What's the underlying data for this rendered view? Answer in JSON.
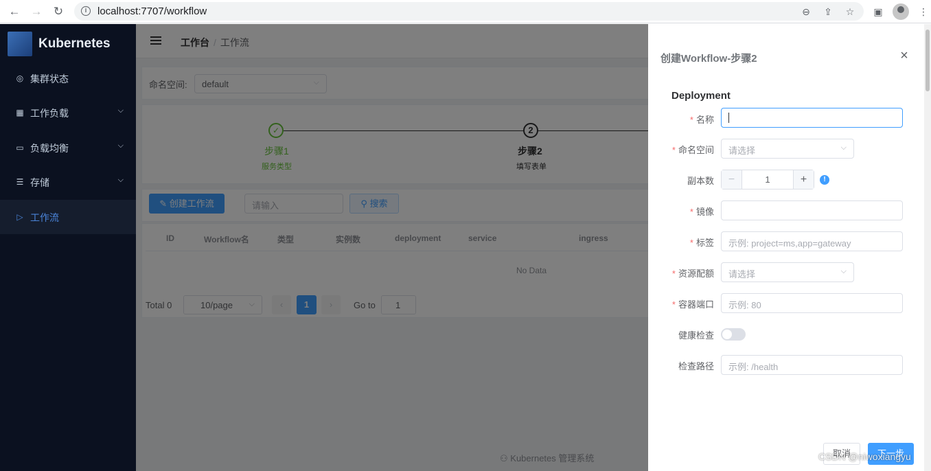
{
  "browser": {
    "url": "localhost:7707/workflow"
  },
  "sidebar": {
    "logo_text": "Kubernetes",
    "items": [
      {
        "label": "集群状态",
        "icon": "dashboard-icon",
        "has_submenu": false
      },
      {
        "label": "工作负载",
        "icon": "grid-icon",
        "has_submenu": true
      },
      {
        "label": "负载均衡",
        "icon": "briefcase-icon",
        "has_submenu": true
      },
      {
        "label": "存储",
        "icon": "document-icon",
        "has_submenu": true
      },
      {
        "label": "工作流",
        "icon": "play-circle-icon",
        "has_submenu": false,
        "active": true
      }
    ]
  },
  "header": {
    "breadcrumb": [
      "工作台",
      "工作流"
    ]
  },
  "filter": {
    "namespace_label": "命名空间:",
    "namespace_value": "default"
  },
  "steps": [
    {
      "number": "1",
      "title": "步骤1",
      "desc": "服务类型",
      "status": "done"
    },
    {
      "number": "2",
      "title": "步骤2",
      "desc": "填写表单",
      "status": "active"
    }
  ],
  "toolbar": {
    "create_label": "创建工作流",
    "search_placeholder": "请输入",
    "search_label": "搜索"
  },
  "table": {
    "columns": [
      "ID",
      "Workflow名",
      "类型",
      "实例数",
      "deployment",
      "service",
      "ingress"
    ],
    "empty_text": "No Data"
  },
  "pagination": {
    "total": "Total 0",
    "page_size": "10/page",
    "current_page": "1",
    "goto_label": "Go to",
    "goto_value": "1"
  },
  "footer": {
    "text": "Kubernetes 管理系统"
  },
  "drawer": {
    "title": "创建Workflow-步骤2",
    "section": "Deployment",
    "fields": {
      "name": {
        "label": "名称",
        "value": "",
        "required": true
      },
      "namespace": {
        "label": "命名空间",
        "placeholder": "请选择",
        "required": true
      },
      "replicas": {
        "label": "副本数",
        "value": "1",
        "required": false
      },
      "image": {
        "label": "镜像",
        "value": "",
        "required": true
      },
      "labels": {
        "label": "标签",
        "placeholder": "示例: project=ms,app=gateway",
        "required": true
      },
      "resources": {
        "label": "资源配额",
        "placeholder": "请选择",
        "required": true
      },
      "port": {
        "label": "容器端口",
        "placeholder": "示例: 80",
        "required": true
      },
      "health": {
        "label": "健康检查",
        "enabled": false,
        "required": false
      },
      "health_path": {
        "label": "检查路径",
        "placeholder": "示例: /health",
        "required": false
      }
    },
    "cancel_label": "取消",
    "next_label": "下一步"
  },
  "watermark": "CSDN @niwoxiangyu",
  "colors": {
    "primary": "#409eff",
    "sidebar_bg": "#0b1120",
    "success": "#67c23a",
    "required": "#f56c6c"
  }
}
